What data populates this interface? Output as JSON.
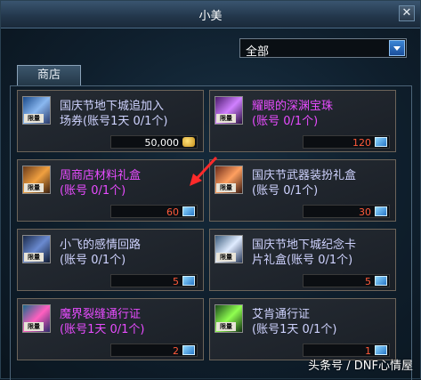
{
  "window": {
    "title": "小美",
    "close_label": "✕"
  },
  "filter": {
    "selected": "全部"
  },
  "tab": {
    "label": "商店"
  },
  "items": [
    {
      "name": "国庆节地下城追加入场券(账号1天 0/1个)",
      "name_display": "国庆节地下城追加入\n场券(账号1天 0/1个)",
      "badge": "限量",
      "price": "50,000",
      "currency": "gold-coins-icon",
      "color": "#cfd3ff"
    },
    {
      "name": "耀眼的深渊宝珠(账号 0/1个)",
      "name_display": "耀眼的深渊宝珠\n(账号 0/1个)",
      "badge": "限量",
      "price": "120",
      "currency": "ticket-icon",
      "color": "#e84cff"
    },
    {
      "name": "周商店材料礼盒(账号 0/1个)",
      "name_display": "周商店材料礼盒\n(账号 0/1个)",
      "badge": "限量",
      "price": "60",
      "currency": "ticket-icon",
      "color": "#e84cff"
    },
    {
      "name": "国庆节武器装扮礼盒(账号 0/1个)",
      "name_display": "国庆节武器装扮礼盒\n(账号 0/1个)",
      "badge": "限量",
      "price": "30",
      "currency": "ticket-icon",
      "color": "#cfd3ff"
    },
    {
      "name": "小飞的感情回路(账号 0/1个)",
      "name_display": "小飞的感情回路\n(账号 0/1个)",
      "badge": "限量",
      "price": "5",
      "currency": "ticket-icon",
      "color": "#cfd3ff"
    },
    {
      "name": "国庆节地下城纪念卡片礼盒(账号 0/1个)",
      "name_display": "国庆节地下城纪念卡\n片礼盒(账号 0/1个)",
      "badge": "限量",
      "price": "5",
      "currency": "ticket-icon",
      "color": "#cfd3ff"
    },
    {
      "name": "魔界裂缝通行证(账号1天 0/1个)",
      "name_display": "魔界裂缝通行证\n(账号1天 0/1个)",
      "badge": "限量",
      "price": "2",
      "currency": "ticket-icon",
      "color": "#e84cff"
    },
    {
      "name": "艾肯通行证(账号1天 0/1个)",
      "name_display": "艾肯通行证\n(账号1天 0/1个)",
      "badge": "限量",
      "price": "1",
      "currency": "ticket-icon",
      "color": "#cfd3ff"
    }
  ],
  "colors": {
    "price_red": "#ff5a3a",
    "price_white": "#ffffff",
    "arrow": "#ff2a2a"
  },
  "watermark": "头条号 / DNF心情屋"
}
